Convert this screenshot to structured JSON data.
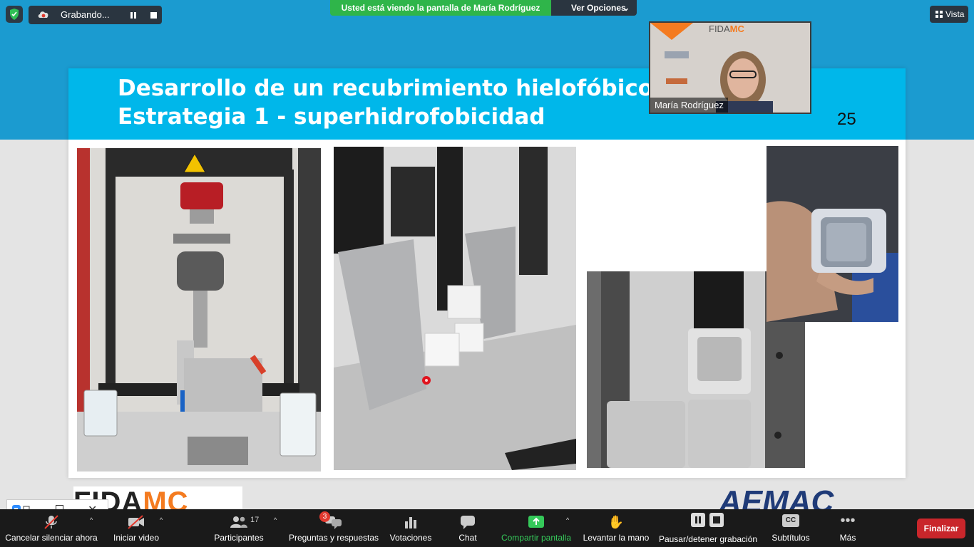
{
  "recording": {
    "label": "Grabando...",
    "pause_icon": "pause-icon",
    "stop_icon": "stop-icon"
  },
  "share_banner": {
    "text": "Usted está viendo la pantalla de  María Rodríguez",
    "options_label": "Ver Opciones"
  },
  "view_button": {
    "label": "Vista"
  },
  "participant_video": {
    "name": "María Rodríguez",
    "logo_text": "FIDAMC"
  },
  "slide": {
    "title_line1": "Desarrollo de un recubrimiento hielofóbico:",
    "title_line2": "Estrategia 1 - superhidrofobicidad",
    "number": "25"
  },
  "footer_logos": {
    "left_a": "FIDA",
    "left_b": "MC",
    "right": "AEMAC"
  },
  "toolbar": {
    "unmute": "Cancelar silenciar ahora",
    "video": "Iniciar video",
    "participants": "Participantes",
    "participants_count": "17",
    "qa": "Preguntas y respuestas",
    "qa_badge": "3",
    "polls": "Votaciones",
    "chat": "Chat",
    "share": "Compartir pantalla",
    "raise_hand": "Levantar la mano",
    "record": "Pausar/detener grabación",
    "captions": "Subtítulos",
    "captions_badge": "CC",
    "more": "Más",
    "end": "Finalizar"
  },
  "colors": {
    "accent_green": "#2fb54a",
    "end_red": "#c9262b",
    "slide_header": "#00b7ea",
    "toolbar_bg": "#1a1a1a"
  }
}
